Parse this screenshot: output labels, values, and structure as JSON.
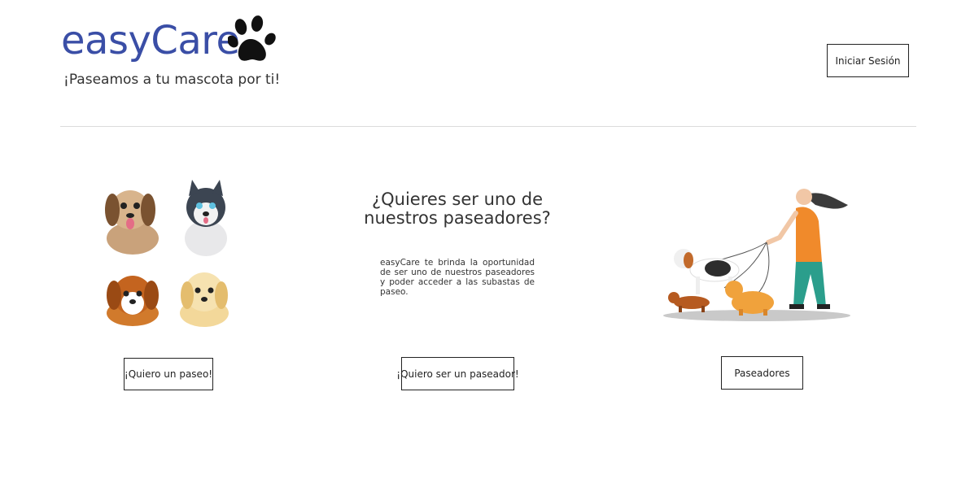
{
  "header": {
    "brand": "easyCare",
    "tagline": "¡Paseamos a tu mascota por ti!",
    "login_label": "Iniciar Sesión",
    "paw_icon": "paw-icon",
    "brand_color": "#3a4ea6"
  },
  "main": {
    "heading": "¿Quieres ser uno de nuestros paseadores?",
    "description": "easyCare te brinda la oportunidad de ser uno de nuestros paseadores y poder acceder a las subastas de paseo.",
    "buttons": {
      "want_walk": "¡Quiero un paseo!",
      "want_walker": "¡Quiero ser un paseador!",
      "walkers": "Paseadores"
    }
  }
}
